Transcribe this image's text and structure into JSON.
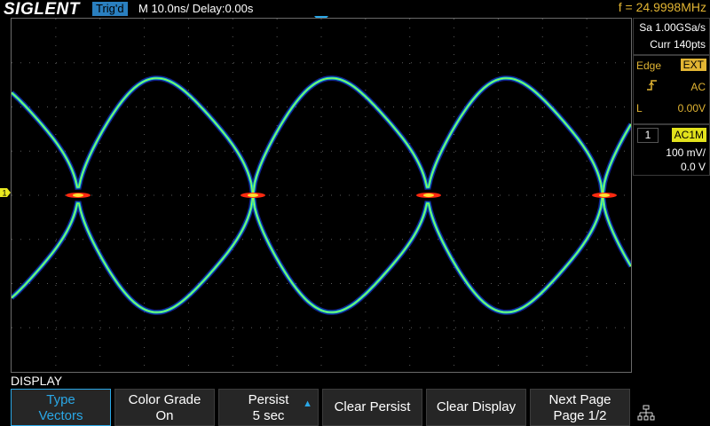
{
  "header": {
    "brand": "SIGLENT",
    "trigger_status": "Trig'd",
    "timebase": "M 10.0ns/  Delay:0.00s",
    "frequency": "f = 24.9998MHz"
  },
  "side_panel": {
    "sample_rate": "Sa 1.00GSa/s",
    "memory": "Curr 140pts",
    "trigger_type": "Edge",
    "trigger_source": "EXT",
    "slope_icon": "rising-edge-icon",
    "coupling": "AC",
    "level_label": "L",
    "level_value": "0.00V",
    "channel": "1",
    "channel_coupling": "AC1M",
    "volts_per_div": "100 mV/",
    "offset": "0.0 V"
  },
  "menu": {
    "title": "DISPLAY",
    "keys": [
      {
        "top": "Type",
        "bottom": "Vectors"
      },
      {
        "top": "Color Grade",
        "bottom": "On"
      },
      {
        "top": "Persist",
        "bottom": "5 sec"
      },
      {
        "single": "Clear Persist"
      },
      {
        "single": "Clear Display"
      },
      {
        "top": "Next Page",
        "bottom": "Page 1/2"
      }
    ]
  },
  "colors": {
    "accent": "#2aa7e6",
    "trigger_yellow": "#e2b533",
    "grid": "#5a5a5a"
  }
}
